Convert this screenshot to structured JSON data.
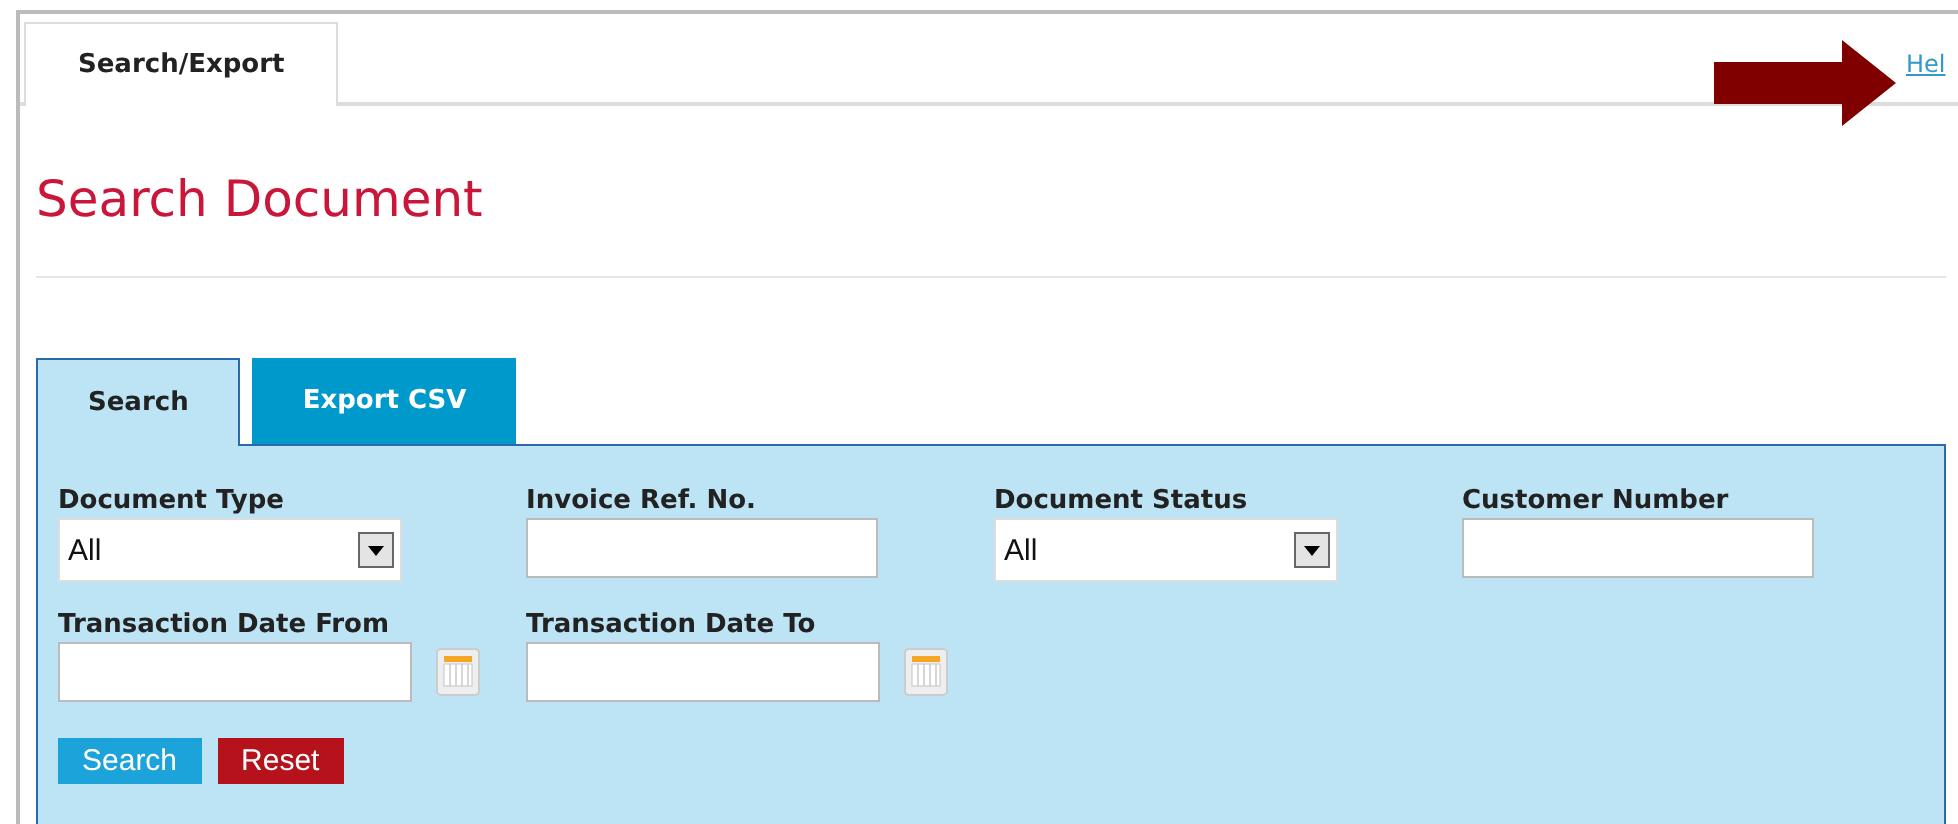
{
  "top_tabs": [
    {
      "label": "Search/Export",
      "selected": true
    }
  ],
  "help_link": "Hel",
  "page_title": "Search Document",
  "tabs": [
    {
      "label": "Search",
      "selected": true
    },
    {
      "label": "Export CSV",
      "selected": false
    }
  ],
  "fields": [
    {
      "label": "Document Type",
      "kind": "select",
      "value": "All"
    },
    {
      "label": "Invoice Ref. No.",
      "kind": "text"
    },
    {
      "label": "Document Status",
      "kind": "select",
      "value": "All"
    },
    {
      "label": "Customer Number",
      "kind": "text"
    },
    {
      "label": "Transaction Date From",
      "kind": "date"
    },
    {
      "label": "Transaction Date To",
      "kind": "date"
    }
  ],
  "buttons": [
    {
      "label": "Search",
      "kind": "primary"
    },
    {
      "label": "Reset",
      "kind": "danger"
    }
  ]
}
